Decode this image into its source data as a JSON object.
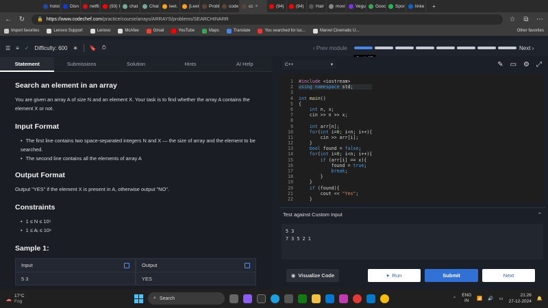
{
  "browser": {
    "tabs": [
      {
        "label": "hotst",
        "color": "#1f4aa8"
      },
      {
        "label": "Disn",
        "color": "#113ccf"
      },
      {
        "label": "netfli",
        "color": "#e50914"
      },
      {
        "label": "(93) I",
        "color": "#ff0000"
      },
      {
        "label": "chat",
        "color": "#74aa9c"
      },
      {
        "label": "Chat",
        "color": "#74aa9c"
      },
      {
        "label": "leet.",
        "color": "#ffa116"
      },
      {
        "label": "[Leet",
        "color": "#ffa116"
      },
      {
        "label": "Probl",
        "color": "#5b4636"
      },
      {
        "label": "code",
        "color": "#5b4636"
      },
      {
        "label": "cc",
        "color": "#5b4636"
      },
      {
        "label": "(94)",
        "color": "#ff0000"
      },
      {
        "label": "(94)",
        "color": "#ff0000"
      },
      {
        "label": "Hair",
        "color": "#555555"
      },
      {
        "label": "movi",
        "color": "#888888"
      },
      {
        "label": "Vegu",
        "color": "#7b2ff7"
      },
      {
        "label": "Gooc",
        "color": "#34a853"
      },
      {
        "label": "Spor",
        "color": "#1db954"
      },
      {
        "label": "linke",
        "color": "#0a66c2"
      }
    ],
    "url_host": "https://www.codechef.com",
    "url_path": "/practice/course/arrays/ARRAYS/problems/SEARCHINARR",
    "bookmarks": [
      {
        "label": "Import favorites",
        "color": "#cccccc"
      },
      {
        "label": "Lenovo Support",
        "color": "#dddddd"
      },
      {
        "label": "Lenovo",
        "color": "#dddddd"
      },
      {
        "label": "McAfee",
        "color": "#dddddd"
      },
      {
        "label": "Gmail",
        "color": "#ea4335"
      },
      {
        "label": "YouTube",
        "color": "#ff0000"
      },
      {
        "label": "Maps",
        "color": "#34a853"
      },
      {
        "label": "Translate",
        "color": "#4285f4"
      },
      {
        "label": "You searched for luc...",
        "color": "#e53935"
      },
      {
        "label": "Marvel Cinematic U...",
        "color": "#dddddd"
      }
    ],
    "other_favorites": "Other favorites"
  },
  "header": {
    "difficulty_label": "Difficulty: 600",
    "prev_label": "Prev module",
    "next_label": "Next",
    "progress_segments": 8,
    "progress_current": 1,
    "progress_tooltip": "1 out of 8"
  },
  "left": {
    "tabs": [
      "Statement",
      "Submissions",
      "Solution",
      "Hints",
      "AI Help"
    ],
    "title": "Search an element in an array",
    "intro": "You are given an array A of size N and an element X. Your task is to find whether the array A contains the element X or not.",
    "input_format_title": "Input Format",
    "input_format": [
      "The first line contains two space-separated integers N and X — the size of array and the element to be searched.",
      "The second line contains all the elements of array A"
    ],
    "output_format_title": "Output Format",
    "output_format": "Output \"YES\" if the element X is present in A, otherwise output \"NO\".",
    "constraints_title": "Constraints",
    "constraints": [
      "1 ≤ N ≤ 10⁵",
      "1 ≤ Aᵢ ≤ 10⁹"
    ],
    "sample_title": "Sample 1:",
    "sample_input_label": "Input",
    "sample_output_label": "Output",
    "sample_input_value": "5 3",
    "sample_output_value": "YES"
  },
  "editor": {
    "language": "C++",
    "lines": [
      "#include <iostream>",
      "using namespace std;",
      "",
      "int main()",
      "{",
      "    int n, x;",
      "    cin >> n >> x;",
      "",
      "    int arr[n];",
      "    for(int i=0; i<n; i++){",
      "        cin >> arr[i];",
      "    }",
      "    bool found = false;",
      "    for(int i=0; i<n; i++){",
      "        if (arr[i] == x){",
      "            found = true;",
      "            break;",
      "        }",
      "    }",
      "    if (found){",
      "        cout << \"Yes\";",
      "    }"
    ],
    "line_numbers": [
      "1",
      "2",
      "3",
      "4",
      "5",
      "6",
      "7",
      "8",
      "9",
      "10",
      "11",
      "12",
      "13",
      "14",
      "15",
      "16",
      "17",
      "18",
      "19",
      "20",
      "21",
      "22"
    ],
    "custom_title": "Test against Custom Input",
    "custom_input_line1": "5 3",
    "custom_input_line2": "7 3 5 2 1",
    "visualize_label": "Visualize Code",
    "run_label": "Run",
    "submit_label": "Submit",
    "next_label": "Next"
  },
  "taskbar": {
    "temperature": "17°C",
    "weather": "Fog",
    "search_label": "Search",
    "lang_line1": "ENG",
    "lang_line2": "IN",
    "time": "21:26",
    "date": "27-12-2024"
  }
}
